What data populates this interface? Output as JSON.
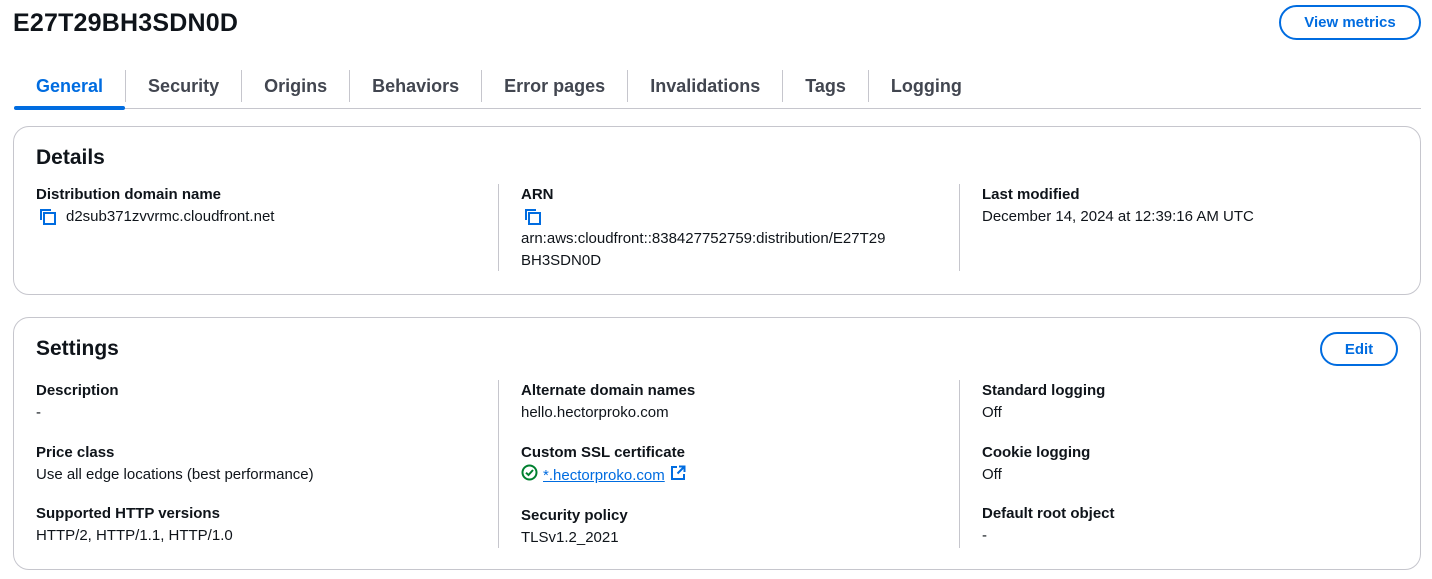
{
  "header": {
    "title": "E27T29BH3SDN0D",
    "view_metrics_label": "View metrics"
  },
  "tabs": [
    {
      "label": "General",
      "active": true
    },
    {
      "label": "Security",
      "active": false
    },
    {
      "label": "Origins",
      "active": false
    },
    {
      "label": "Behaviors",
      "active": false
    },
    {
      "label": "Error pages",
      "active": false
    },
    {
      "label": "Invalidations",
      "active": false
    },
    {
      "label": "Tags",
      "active": false
    },
    {
      "label": "Logging",
      "active": false
    }
  ],
  "details": {
    "title": "Details",
    "domain_label": "Distribution domain name",
    "domain_value": "d2sub371zvvrmc.cloudfront.net",
    "arn_label": "ARN",
    "arn_value_line1": "arn:aws:cloudfront::838427752759:distribution/E27T29",
    "arn_value_line2": "BH3SDN0D",
    "modified_label": "Last modified",
    "modified_value": "December 14, 2024 at 12:39:16 AM UTC"
  },
  "settings": {
    "title": "Settings",
    "edit_label": "Edit",
    "description_label": "Description",
    "description_value": "-",
    "price_label": "Price class",
    "price_value": "Use all edge locations (best performance)",
    "http_label": "Supported HTTP versions",
    "http_value": "HTTP/2, HTTP/1.1, HTTP/1.0",
    "alt_domain_label": "Alternate domain names",
    "alt_domain_value": "hello.hectorproko.com",
    "ssl_label": "Custom SSL certificate",
    "ssl_value": "*.hectorproko.com",
    "policy_label": "Security policy",
    "policy_value": "TLSv1.2_2021",
    "std_logging_label": "Standard logging",
    "std_logging_value": "Off",
    "cookie_logging_label": "Cookie logging",
    "cookie_logging_value": "Off",
    "root_object_label": "Default root object",
    "root_object_value": "-"
  },
  "colors": {
    "accent": "#006ce0",
    "border": "#c6c6cd",
    "success": "#00802f",
    "text": "#0f141a"
  },
  "icons": {
    "copy": "copy-icon",
    "status_ok": "check-circle-icon",
    "external": "external-link-icon"
  }
}
